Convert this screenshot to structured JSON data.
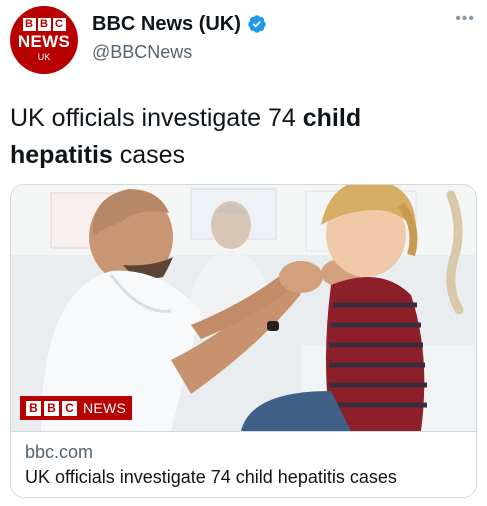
{
  "account": {
    "avatar_blocks": [
      "B",
      "B",
      "C"
    ],
    "avatar_news": "NEWS",
    "avatar_uk": "UK",
    "display_name": "BBC News (UK)",
    "handle": "@BBCNews",
    "verified": true
  },
  "more_glyph": "•••",
  "tweet": {
    "text_part1": "UK officials investigate 74 ",
    "text_bold": "child hepatitis",
    "text_part2": " cases"
  },
  "card": {
    "overlay_blocks": [
      "B",
      "B",
      "C"
    ],
    "overlay_news": "NEWS",
    "domain": "bbc.com",
    "title": "UK officials investigate 74 child hepatitis cases"
  },
  "colors": {
    "bbc_red": "#b80000",
    "verified_blue": "#1d9bf0",
    "secondary_text": "#536471",
    "border": "#cfd9de"
  },
  "icons": {
    "verified": "verified-badge-icon",
    "more": "more-options-icon"
  }
}
